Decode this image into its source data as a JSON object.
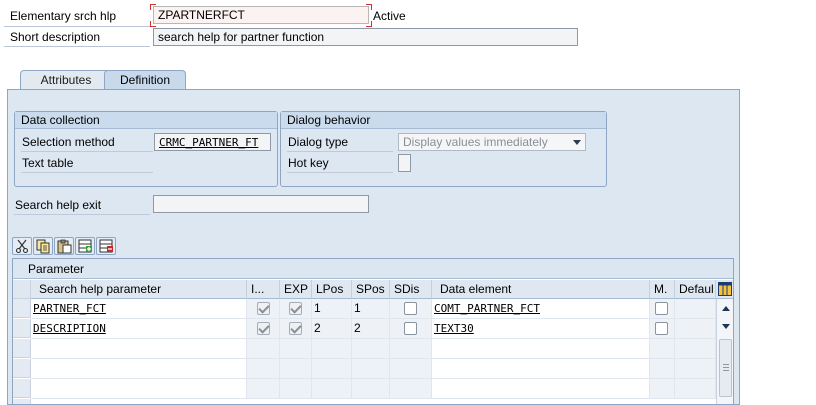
{
  "header": {
    "type_label": "Elementary srch hlp",
    "name_value": "ZPARTNERFCT",
    "status": "Active",
    "short_desc_label": "Short description",
    "short_desc_value": "search help for partner function"
  },
  "tabs": [
    {
      "label": "Attributes",
      "active": false
    },
    {
      "label": "Definition",
      "active": true
    }
  ],
  "data_collection": {
    "title": "Data collection",
    "selection_method_label": "Selection method",
    "selection_method_value": "CRMC_PARTNER_FT",
    "text_table_label": "Text table",
    "text_table_value": ""
  },
  "dialog_behavior": {
    "title": "Dialog behavior",
    "dialog_type_label": "Dialog type",
    "dialog_type_value": "Display values immediately",
    "hot_key_label": "Hot key",
    "hot_key_value": ""
  },
  "search_help_exit": {
    "label": "Search help exit",
    "value": ""
  },
  "toolbar": {
    "buttons": [
      "cut-icon",
      "copy-icon",
      "paste-icon",
      "insert-row-icon",
      "delete-row-icon"
    ]
  },
  "parameter_table": {
    "title": "Parameter",
    "columns": [
      "Search help parameter",
      "I...",
      "EXP",
      "LPos",
      "SPos",
      "SDis",
      "Data element",
      "M.",
      "Defaul"
    ],
    "rows": [
      {
        "param": "PARTNER_FCT",
        "imp": true,
        "exp": true,
        "lpos": "1",
        "spos": "1",
        "sdis": false,
        "data_element": "COMT_PARTNER_FCT",
        "m": false
      },
      {
        "param": "DESCRIPTION",
        "imp": true,
        "exp": true,
        "lpos": "2",
        "spos": "2",
        "sdis": false,
        "data_element": "TEXT30",
        "m": false
      }
    ]
  },
  "colors": {
    "panel_bg": "#dde7f1",
    "border": "#8ea6c4",
    "required_corner": "#d32f2f"
  }
}
